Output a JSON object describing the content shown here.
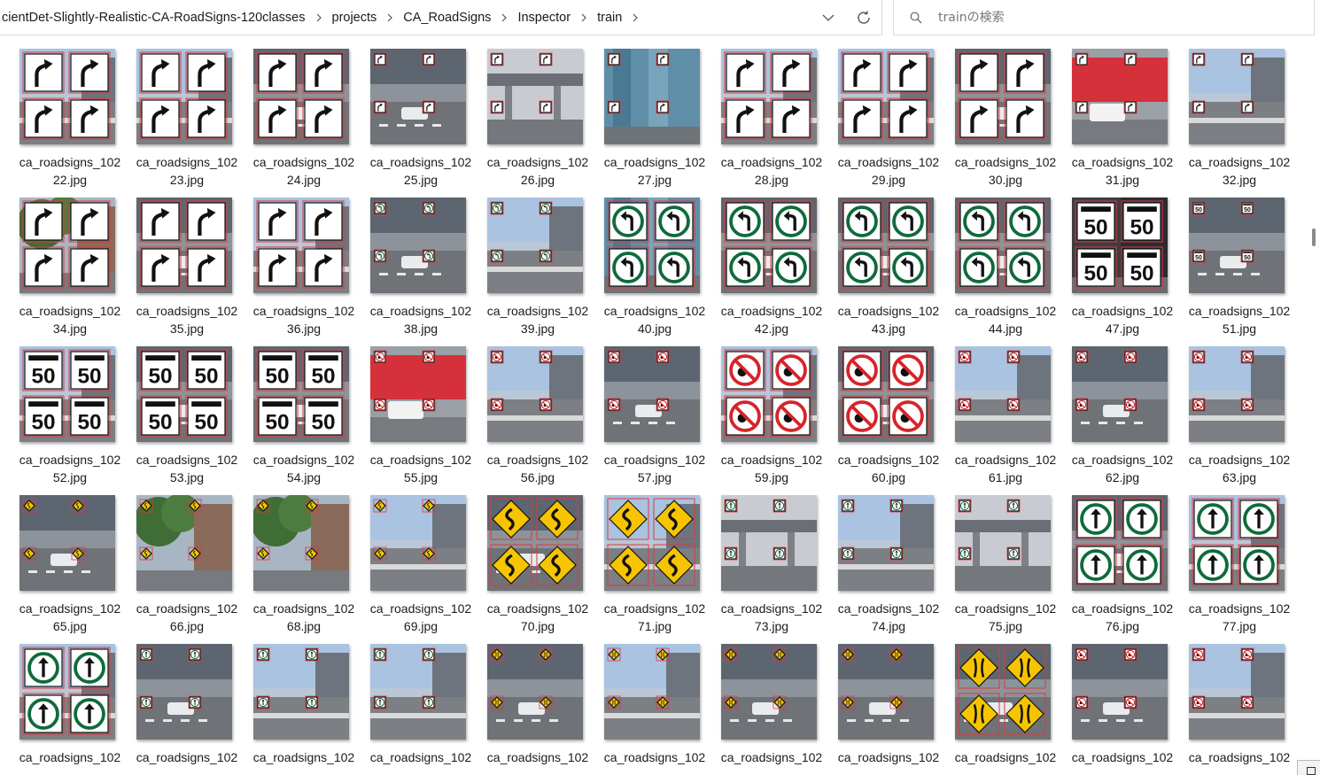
{
  "address_bar": {
    "crumbs": [
      "cientDet-Slightly-Realistic-CA-RoadSigns-120classes",
      "projects",
      "CA_RoadSigns",
      "Inspector",
      "train"
    ],
    "dropdown_icon": "chevron-down-icon",
    "refresh_icon": "refresh-icon"
  },
  "search": {
    "placeholder": "trainの検索",
    "icon": "search-icon"
  },
  "files": [
    {
      "line1": "ca_roadsigns_102",
      "line2": "22.jpg",
      "sign": "curve",
      "bg": "sky",
      "big": true
    },
    {
      "line1": "ca_roadsigns_102",
      "line2": "23.jpg",
      "sign": "curve",
      "bg": "sky",
      "big": true
    },
    {
      "line1": "ca_roadsigns_102",
      "line2": "24.jpg",
      "sign": "curve",
      "bg": "street",
      "big": true
    },
    {
      "line1": "ca_roadsigns_102",
      "line2": "25.jpg",
      "sign": "curve",
      "bg": "street",
      "big": false
    },
    {
      "line1": "ca_roadsigns_102",
      "line2": "26.jpg",
      "sign": "curve",
      "bg": "overpass",
      "big": false
    },
    {
      "line1": "ca_roadsigns_102",
      "line2": "27.jpg",
      "sign": "curve",
      "bg": "glass",
      "big": false
    },
    {
      "line1": "ca_roadsigns_102",
      "line2": "28.jpg",
      "sign": "curve",
      "bg": "sky",
      "big": true
    },
    {
      "line1": "ca_roadsigns_102",
      "line2": "29.jpg",
      "sign": "curve",
      "bg": "sky",
      "big": true
    },
    {
      "line1": "ca_roadsigns_102",
      "line2": "30.jpg",
      "sign": "curve",
      "bg": "street",
      "big": true
    },
    {
      "line1": "ca_roadsigns_102",
      "line2": "31.jpg",
      "sign": "curve",
      "bg": "redwall",
      "big": false
    },
    {
      "line1": "ca_roadsigns_102",
      "line2": "32.jpg",
      "sign": "curve",
      "bg": "sky",
      "big": false
    },
    {
      "line1": "ca_roadsigns_102",
      "line2": "34.jpg",
      "sign": "curve",
      "bg": "tree",
      "big": true
    },
    {
      "line1": "ca_roadsigns_102",
      "line2": "35.jpg",
      "sign": "curve",
      "bg": "street",
      "big": true
    },
    {
      "line1": "ca_roadsigns_102",
      "line2": "36.jpg",
      "sign": "curve",
      "bg": "sky",
      "big": true
    },
    {
      "line1": "ca_roadsigns_102",
      "line2": "38.jpg",
      "sign": "turnleft",
      "bg": "street",
      "big": false
    },
    {
      "line1": "ca_roadsigns_102",
      "line2": "39.jpg",
      "sign": "turnleft",
      "bg": "sky",
      "big": false
    },
    {
      "line1": "ca_roadsigns_102",
      "line2": "40.jpg",
      "sign": "turnleft",
      "bg": "glass",
      "big": true
    },
    {
      "line1": "ca_roadsigns_102",
      "line2": "42.jpg",
      "sign": "turnleft",
      "bg": "street",
      "big": true
    },
    {
      "line1": "ca_roadsigns_102",
      "line2": "43.jpg",
      "sign": "turnleft",
      "bg": "street",
      "big": true
    },
    {
      "line1": "ca_roadsigns_102",
      "line2": "44.jpg",
      "sign": "turnleft",
      "bg": "street",
      "big": true
    },
    {
      "line1": "ca_roadsigns_102",
      "line2": "47.jpg",
      "sign": "max50",
      "bg": "dark",
      "big": true
    },
    {
      "line1": "ca_roadsigns_102",
      "line2": "51.jpg",
      "sign": "max50",
      "bg": "street",
      "big": false
    },
    {
      "line1": "ca_roadsigns_102",
      "line2": "52.jpg",
      "sign": "max50",
      "bg": "sky",
      "big": true
    },
    {
      "line1": "ca_roadsigns_102",
      "line2": "53.jpg",
      "sign": "max50",
      "bg": "street",
      "big": true
    },
    {
      "line1": "ca_roadsigns_102",
      "line2": "54.jpg",
      "sign": "max50",
      "bg": "street",
      "big": true
    },
    {
      "line1": "ca_roadsigns_102",
      "line2": "55.jpg",
      "sign": "noentry",
      "bg": "redwall",
      "big": false
    },
    {
      "line1": "ca_roadsigns_102",
      "line2": "56.jpg",
      "sign": "noentry",
      "bg": "sky",
      "big": false
    },
    {
      "line1": "ca_roadsigns_102",
      "line2": "57.jpg",
      "sign": "noentry",
      "bg": "street",
      "big": false
    },
    {
      "line1": "ca_roadsigns_102",
      "line2": "59.jpg",
      "sign": "noentry",
      "bg": "sky",
      "big": true
    },
    {
      "line1": "ca_roadsigns_102",
      "line2": "60.jpg",
      "sign": "noentry",
      "bg": "street",
      "big": true
    },
    {
      "line1": "ca_roadsigns_102",
      "line2": "61.jpg",
      "sign": "noentry",
      "bg": "sky",
      "big": false
    },
    {
      "line1": "ca_roadsigns_102",
      "line2": "62.jpg",
      "sign": "noentry",
      "bg": "street",
      "big": false
    },
    {
      "line1": "ca_roadsigns_102",
      "line2": "63.jpg",
      "sign": "noentry",
      "bg": "sky",
      "big": false
    },
    {
      "line1": "ca_roadsigns_102",
      "line2": "65.jpg",
      "sign": "winding",
      "bg": "street",
      "big": false
    },
    {
      "line1": "ca_roadsigns_102",
      "line2": "66.jpg",
      "sign": "winding",
      "bg": "tree",
      "big": false
    },
    {
      "line1": "ca_roadsigns_102",
      "line2": "68.jpg",
      "sign": "winding",
      "bg": "tree",
      "big": false
    },
    {
      "line1": "ca_roadsigns_102",
      "line2": "69.jpg",
      "sign": "winding",
      "bg": "sky",
      "big": false
    },
    {
      "line1": "ca_roadsigns_102",
      "line2": "70.jpg",
      "sign": "winding",
      "bg": "street",
      "big": true
    },
    {
      "line1": "ca_roadsigns_102",
      "line2": "71.jpg",
      "sign": "winding",
      "bg": "sky",
      "big": true
    },
    {
      "line1": "ca_roadsigns_102",
      "line2": "73.jpg",
      "sign": "straight",
      "bg": "overpass",
      "big": false
    },
    {
      "line1": "ca_roadsigns_102",
      "line2": "74.jpg",
      "sign": "straight",
      "bg": "sky",
      "big": false
    },
    {
      "line1": "ca_roadsigns_102",
      "line2": "75.jpg",
      "sign": "straight",
      "bg": "overpass",
      "big": false
    },
    {
      "line1": "ca_roadsigns_102",
      "line2": "76.jpg",
      "sign": "straight",
      "bg": "street",
      "big": true
    },
    {
      "line1": "ca_roadsigns_102",
      "line2": "77.jpg",
      "sign": "straight",
      "bg": "sky",
      "big": true
    },
    {
      "line1": "ca_roadsigns_102",
      "line2": "",
      "sign": "straight",
      "bg": "sky",
      "big": true
    },
    {
      "line1": "ca_roadsigns_102",
      "line2": "",
      "sign": "straight",
      "bg": "street",
      "big": false
    },
    {
      "line1": "ca_roadsigns_102",
      "line2": "",
      "sign": "straight",
      "bg": "sky",
      "big": false
    },
    {
      "line1": "ca_roadsigns_102",
      "line2": "",
      "sign": "straight",
      "bg": "sky",
      "big": false
    },
    {
      "line1": "ca_roadsigns_102",
      "line2": "",
      "sign": "narrow",
      "bg": "street",
      "big": false
    },
    {
      "line1": "ca_roadsigns_102",
      "line2": "",
      "sign": "narrow",
      "bg": "sky",
      "big": false
    },
    {
      "line1": "ca_roadsigns_102",
      "line2": "",
      "sign": "narrow",
      "bg": "street",
      "big": false
    },
    {
      "line1": "ca_roadsigns_102",
      "line2": "",
      "sign": "narrow",
      "bg": "street",
      "big": false
    },
    {
      "line1": "ca_roadsigns_102",
      "line2": "",
      "sign": "narrow",
      "bg": "street",
      "big": true
    },
    {
      "line1": "ca_roadsigns_102",
      "line2": "",
      "sign": "nobike",
      "bg": "street",
      "big": false
    },
    {
      "line1": "ca_roadsigns_102",
      "line2": "",
      "sign": "nobike",
      "bg": "sky",
      "big": false
    }
  ],
  "colors": {
    "bbox": "#e0383b",
    "sign_green": "#0f6b3a",
    "sign_yellow": "#f6c400",
    "sign_red": "#d8232a"
  }
}
